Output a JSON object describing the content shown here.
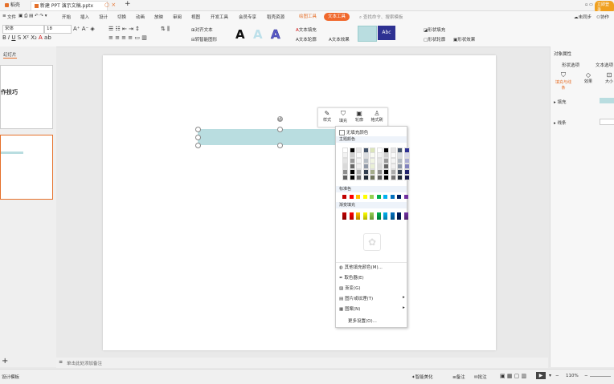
{
  "titlebar": {
    "tabs": [
      {
        "label": "稻壳"
      },
      {
        "label": "新建 PPT 演示文稿.pptx"
      }
    ],
    "right_label": "立即登录"
  },
  "menubar": {
    "file": "文件",
    "items": [
      "开始",
      "插入",
      "设计",
      "切换",
      "动画",
      "放映",
      "审阅",
      "视图",
      "开发工具",
      "会员专享",
      "稻壳资源"
    ],
    "drawing_tool": "绘图工具",
    "text_tool": "文本工具",
    "search_placeholder": "查找命令、搜索模板",
    "sync": "未同步",
    "collab": "协作"
  },
  "ribbon": {
    "font_name": "宋体",
    "font_size": "18",
    "align_text": "对齐文本",
    "smart_art": "转智能图形",
    "text_fill": "文本填充",
    "text_outline": "文本轮廓",
    "text_effect": "文本效果",
    "shape_fill": "形状填充",
    "shape_outline": "形状轮廓",
    "shape_effect": "形状效果",
    "style_sample": "Abc"
  },
  "leftpane": {
    "tab_label": "幻灯片",
    "thumb1_text": "作技巧"
  },
  "floating_toolbar": {
    "style": "样式",
    "fill": "填充",
    "outline": "轮廓",
    "format_painter": "格式刷"
  },
  "popup": {
    "no_fill": "无填充颜色",
    "theme_colors": "主题颜色",
    "standard_colors": "标准色",
    "gradient_fill": "渐变填充",
    "more_colors": "其他填充颜色(M)...",
    "eyedropper": "取色器(E)",
    "gradient": "渐变(G)",
    "picture_texture": "图片或纹理(T)",
    "pattern": "图案(N)",
    "more_settings": "更多设置(O)...",
    "standard_palette": [
      "#c00000",
      "#ff0000",
      "#ffc000",
      "#ffff00",
      "#92d050",
      "#00b050",
      "#00b0f0",
      "#0070c0",
      "#002060",
      "#7030a0"
    ],
    "gradient_palette": [
      "#c00000",
      "#ff0000",
      "#ffc000",
      "#ffff00",
      "#92d050",
      "#00b050",
      "#00b0f0",
      "#0070c0",
      "#002060",
      "#7030a0"
    ],
    "theme_top": [
      "#ffffff",
      "#000000",
      "#e7e6e6",
      "#44546a",
      "#dbe5b9",
      "#ffffff",
      "#000000",
      "#e7e6e6",
      "#44546a",
      "#2e3192"
    ]
  },
  "rightpane": {
    "title": "对象属性",
    "tab1": "形状选项",
    "tab2": "文本选项",
    "sub1": "填充与线条",
    "sub2": "效果",
    "sub3": "大小",
    "fill": "填充",
    "line": "线条"
  },
  "notes": {
    "placeholder": "单击此处添加备注"
  },
  "statusbar": {
    "left": "设计模板",
    "smart_beauty": "智能美化",
    "remarks": "备注",
    "comments": "批注",
    "zoom": "110%"
  },
  "colors": {
    "shape_fill": "#b9dde0",
    "text_tool": "#f0682c",
    "accent_orange": "#e5702a"
  }
}
